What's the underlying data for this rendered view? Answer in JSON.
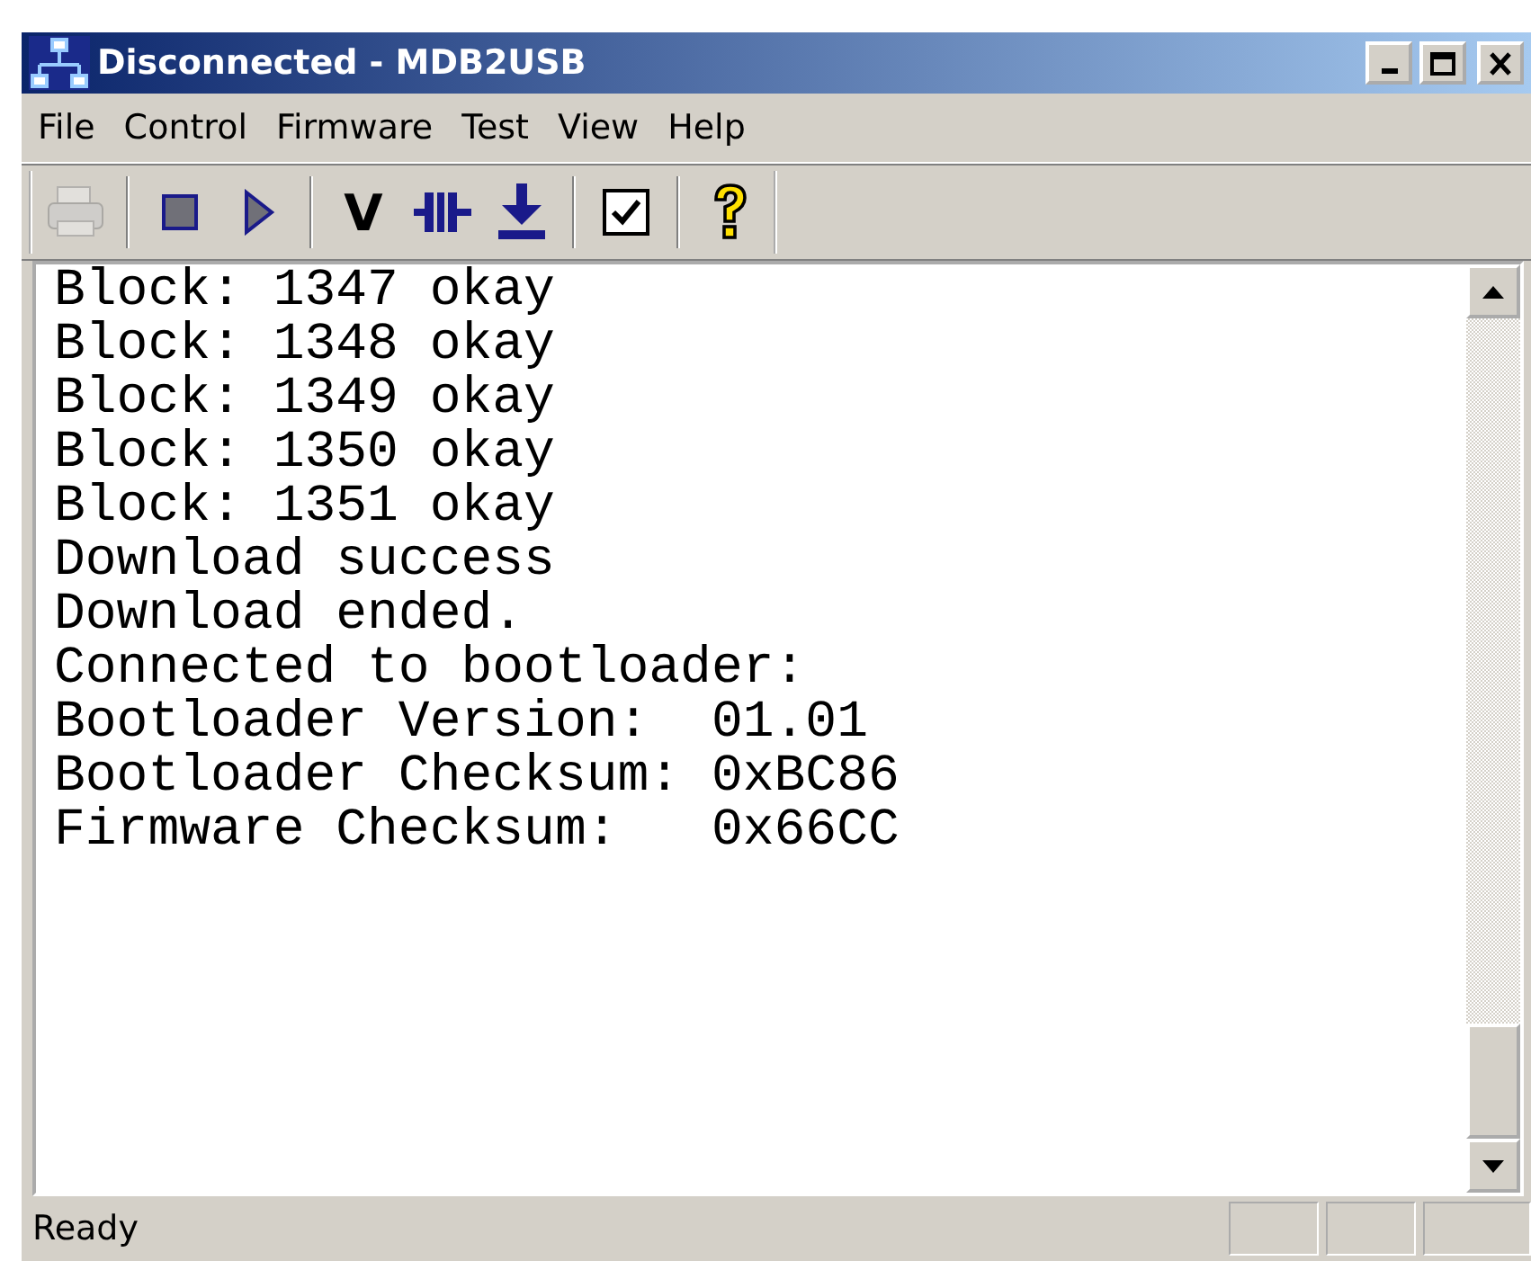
{
  "window": {
    "title": "Disconnected - MDB2USB"
  },
  "menu": [
    {
      "label": "File"
    },
    {
      "label": "Control"
    },
    {
      "label": "Firmware"
    },
    {
      "label": "Test"
    },
    {
      "label": "View"
    },
    {
      "label": "Help"
    }
  ],
  "toolbar": [
    {
      "kind": "print",
      "disabled": true
    },
    {
      "kind": "separator"
    },
    {
      "kind": "stop",
      "disabled": false
    },
    {
      "kind": "play",
      "disabled": false
    },
    {
      "kind": "separator"
    },
    {
      "kind": "text",
      "label": "V",
      "disabled": false
    },
    {
      "kind": "connect",
      "disabled": false
    },
    {
      "kind": "download",
      "disabled": false
    },
    {
      "kind": "separator"
    },
    {
      "kind": "check",
      "checked": true,
      "disabled": false
    },
    {
      "kind": "separator"
    },
    {
      "kind": "help",
      "disabled": false
    }
  ],
  "log": [
    "Block: 1347 okay",
    "Block: 1348 okay",
    "Block: 1349 okay",
    "Block: 1350 okay",
    "Block: 1351 okay",
    "Download success",
    "Download ended.",
    "Connected to bootloader:",
    "Bootloader Version:  01.01",
    "Bootloader Checksum: 0xBC86",
    "Firmware Checksum:   0x66CC"
  ],
  "status_bar": {
    "text": "Ready"
  }
}
